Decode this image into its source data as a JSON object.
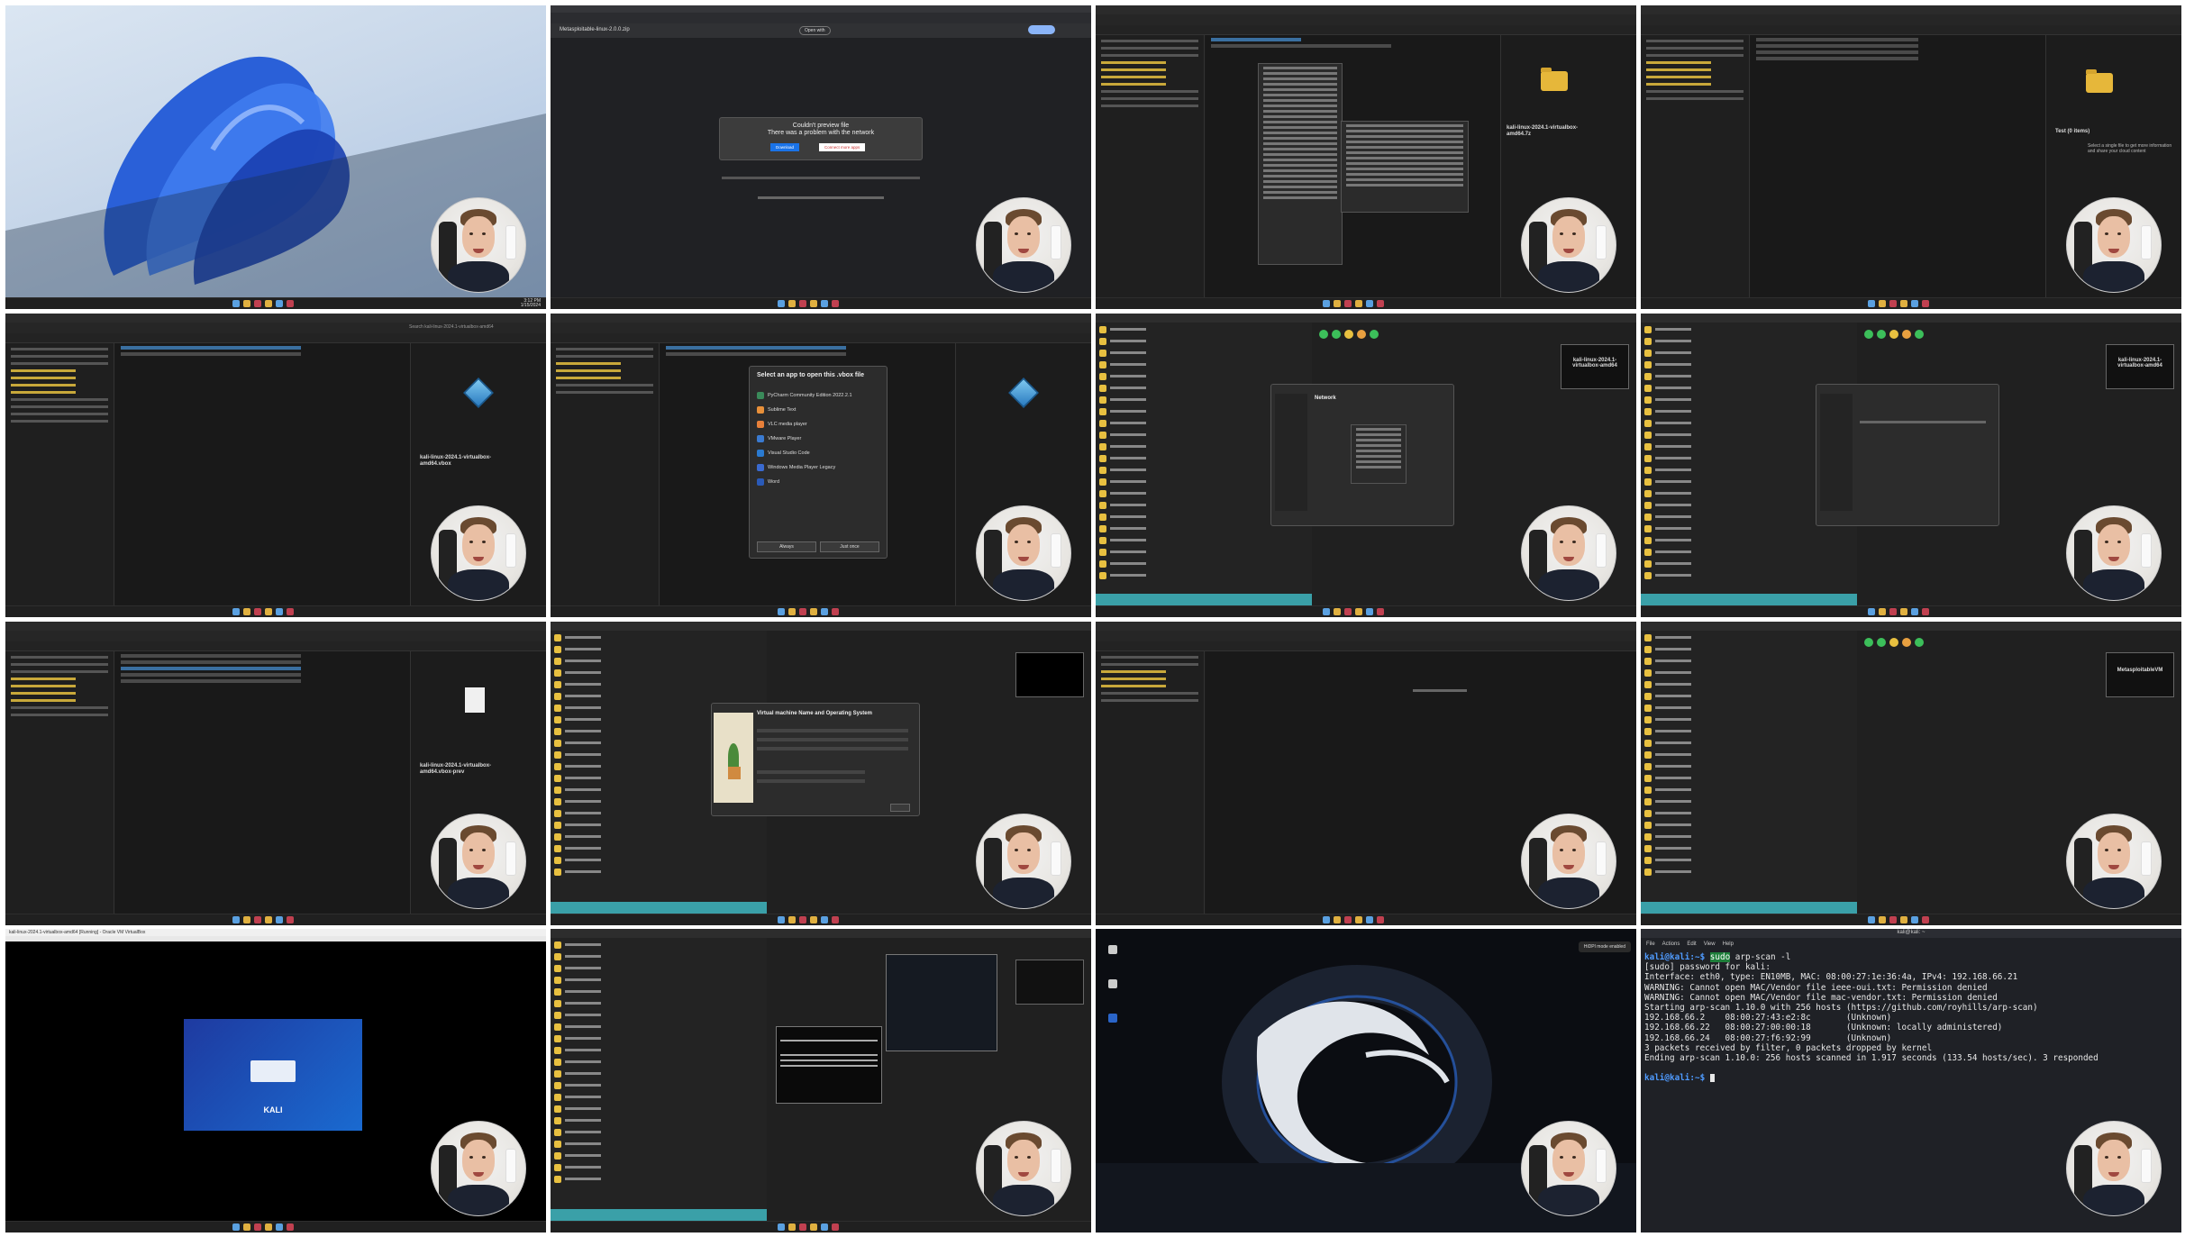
{
  "tiles": [
    {
      "id": "t1",
      "name": "Windows 11 desktop wallpaper"
    },
    {
      "id": "t2",
      "name": "Browser file preview",
      "tab": "Metasploitable-linux-2.0.0.zip",
      "open_with": "Open with",
      "error_title": "Couldn't preview file",
      "error_sub": "There was a problem with the network",
      "download": "Download",
      "connect": "Connect more apps"
    },
    {
      "id": "t3",
      "name": "Explorer context menu",
      "path": "Downloads  >  Test",
      "folder_label": "Test",
      "file": "Metasploitable-linux-2.0.0.zip",
      "side_title": "kali-linux-2024.1-virtualbox-amd64.7z"
    },
    {
      "id": "t4",
      "name": "Explorer Test folder",
      "empty_text": "Test (0 items)",
      "hint": "Select a single file to get more information and share your cloud content"
    },
    {
      "id": "t5",
      "name": "Explorer vbox file",
      "search": "Search kali-linux-2024.1-virtualbox-amd64",
      "file_title": "kali-linux-2024.1-virtualbox-amd64.vbox"
    },
    {
      "id": "t6",
      "name": "Open with dialog",
      "dialog_title": "Select an app to open this .vbox file",
      "apps": [
        "PyCharm Community Edition 2022.2.1",
        "Sublime Text",
        "VLC media player",
        "VMware Player",
        "Visual Studio Code",
        "Windows Media Player Legacy",
        "Word"
      ],
      "always": "Always",
      "just_once": "Just once"
    },
    {
      "id": "t7",
      "name": "VirtualBox network settings",
      "preview": "kali-linux-2024.1-virtualbox-amd64",
      "dialog": "Network"
    },
    {
      "id": "t8",
      "name": "VirtualBox network settings 2",
      "preview": "kali-linux-2024.1-virtualbox-amd64"
    },
    {
      "id": "t9",
      "name": "Explorer vbox-prev",
      "file_title": "kali-linux-2024.1-virtualbox-amd64.vbox-prev"
    },
    {
      "id": "t10",
      "name": "Create virtual machine",
      "dialog_title": "Virtual machine Name and Operating System"
    },
    {
      "id": "t11",
      "name": "Explorer Metasploitable folder"
    },
    {
      "id": "t12",
      "name": "VirtualBox Metasploitable",
      "preview": "MetasploitableVM"
    },
    {
      "id": "t13",
      "name": "Kali VM boot window",
      "window_title": "kali-linux-2024.1-virtualbox-amd64 [Running] - Oracle VM VirtualBox",
      "logo": "KALI"
    },
    {
      "id": "t14",
      "name": "VirtualBox both VMs running"
    },
    {
      "id": "t15",
      "name": "Kali desktop",
      "notice": "HiDPI mode enabled"
    },
    {
      "id": "t16",
      "name": "Kali terminal arp-scan"
    }
  ],
  "taskbar": {
    "time": "3:12 PM",
    "date": "1/15/2024"
  },
  "terminal": {
    "menu": [
      "File",
      "Actions",
      "Edit",
      "View",
      "Help"
    ],
    "tab": "kali@kali: ~",
    "prompt": "kali@kali:~$",
    "command": "sudo arp-scan -l",
    "cmd_rest": " arp-scan -l",
    "cmd_sudo": "sudo",
    "lines": [
      "[sudo] password for kali:",
      "Interface: eth0, type: EN10MB, MAC: 08:00:27:1e:36:4a, IPv4: 192.168.66.21",
      "WARNING: Cannot open MAC/Vendor file ieee-oui.txt: Permission denied",
      "WARNING: Cannot open MAC/Vendor file mac-vendor.txt: Permission denied",
      "Starting arp-scan 1.10.0 with 256 hosts (https://github.com/royhills/arp-scan)",
      "192.168.66.2    08:00:27:43:e2:8c       (Unknown)",
      "192.168.66.22   08:00:27:00:00:18       (Unknown: locally administered)",
      "192.168.66.24   08:00:27:f6:92:99       (Unknown)",
      "",
      "3 packets received by filter, 0 packets dropped by kernel",
      "Ending arp-scan 1.10.0: 256 hosts scanned in 1.917 seconds (133.54 hosts/sec). 3 responded"
    ]
  },
  "colors": {
    "tile_bg": "#1b1b1b",
    "accent": "#3aa0a8",
    "kali_blue": "#4f9bff",
    "win_blue": "#2a60d8"
  }
}
